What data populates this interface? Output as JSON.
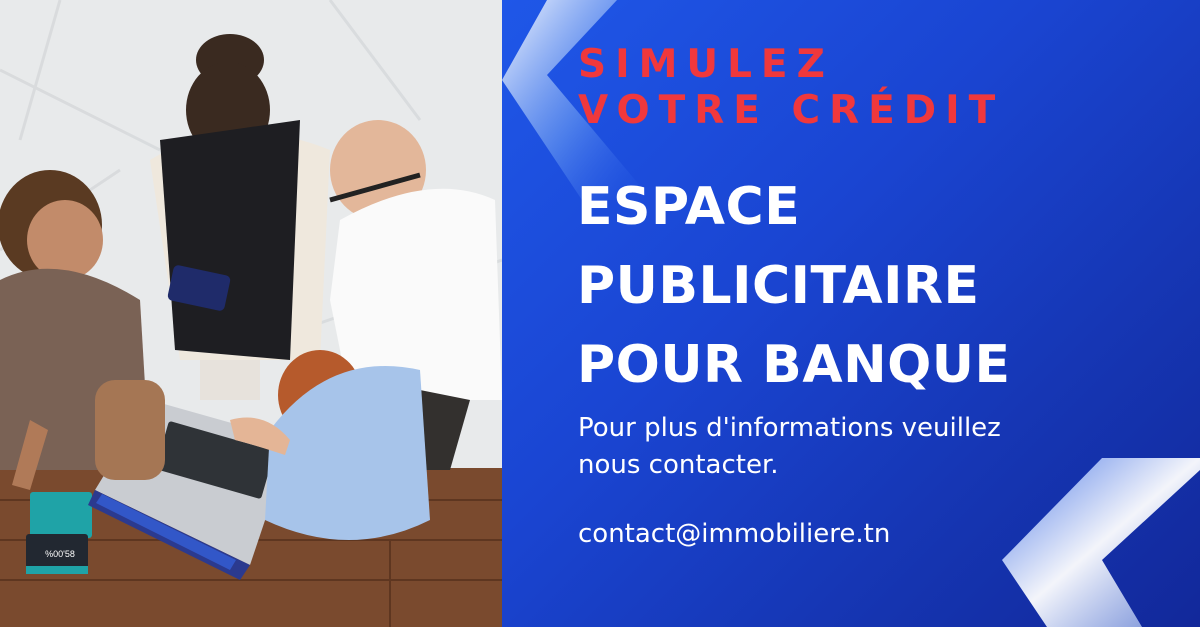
{
  "tagline": {
    "line1": "SIMULEZ",
    "line2": "VOTRE CRÉDIT"
  },
  "headline": {
    "line1": "ESPACE",
    "line2": "PUBLICITAIRE",
    "line3": "POUR BANQUE"
  },
  "info_text_line1": "Pour plus d'informations veuillez",
  "info_text_line2": "nous contacter.",
  "contact_email": "contact@immobiliere.tn",
  "phone_screen_text": "%00'58",
  "colors": {
    "tagline": "#f0383c",
    "panel_blue": "#1a45d2",
    "text": "#ffffff"
  }
}
